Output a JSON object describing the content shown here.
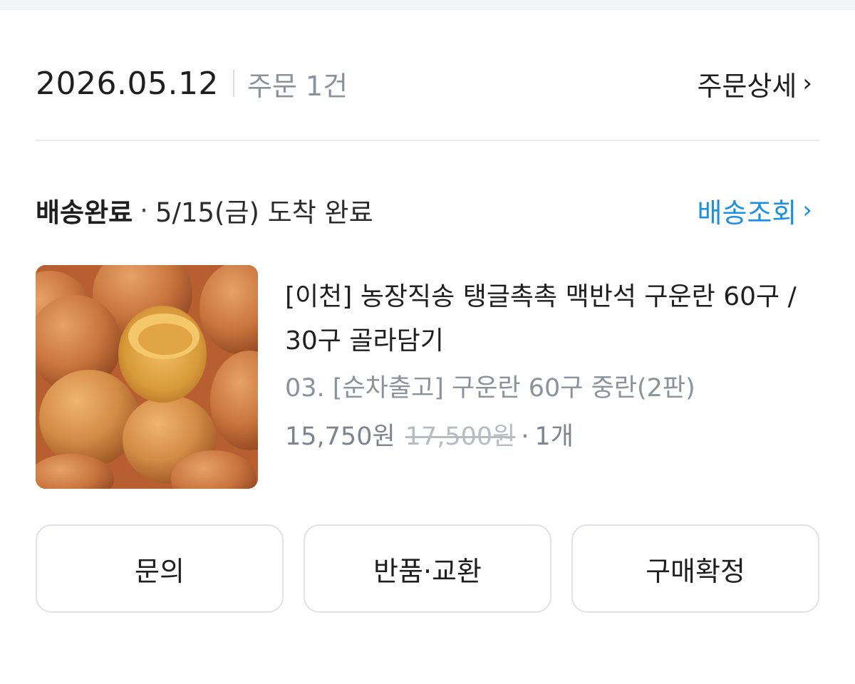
{
  "order": {
    "date": "2026.05.12",
    "count_label": "주문 1건",
    "detail_label": "주문상세",
    "chevron": "›"
  },
  "shipping": {
    "status": "배송완료",
    "separator": "·",
    "arrival_text": "5/15(금) 도착 완료",
    "track_label": "배송조회",
    "track_color": "#1a8fe6",
    "chevron": "›"
  },
  "product": {
    "image_icon": "boiled-eggs-photo",
    "title": "[이천] 농장직송 탱글촉촉 맥반석 구운란 60구 / 30구 골라담기",
    "option": "03. [순차출고] 구운란 60구 중란(2판)",
    "sale_price": "15,750원",
    "original_price": "17,500원",
    "dot": "·",
    "quantity": "1개"
  },
  "actions": {
    "inquiry": "문의",
    "return_exchange": "반품·교환",
    "confirm_purchase": "구매확정"
  }
}
